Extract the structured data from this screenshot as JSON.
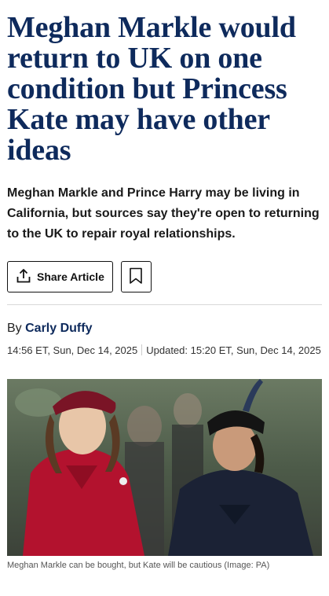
{
  "article": {
    "headline": "Meghan Markle would return to UK on one condition but Princess Kate may have other ideas",
    "standfirst": "Meghan Markle and Prince Harry may be living in California, but sources say they're open to returning to the UK to repair royal relationships.",
    "share_label": "Share Article",
    "byline_prefix": "By",
    "author": "Carly Duffy",
    "published": "14:56 ET, Sun, Dec 14, 2025",
    "updated": "Updated: 15:20 ET, Sun, Dec 14, 2025",
    "image_caption": "Meghan Markle can be bought, but Kate will be cautious (Image: PA)"
  },
  "icons": {
    "share": "share-upload-icon",
    "bookmark": "bookmark-icon"
  },
  "colors": {
    "headline": "#0e2a5c",
    "author": "#0e2a5c"
  }
}
